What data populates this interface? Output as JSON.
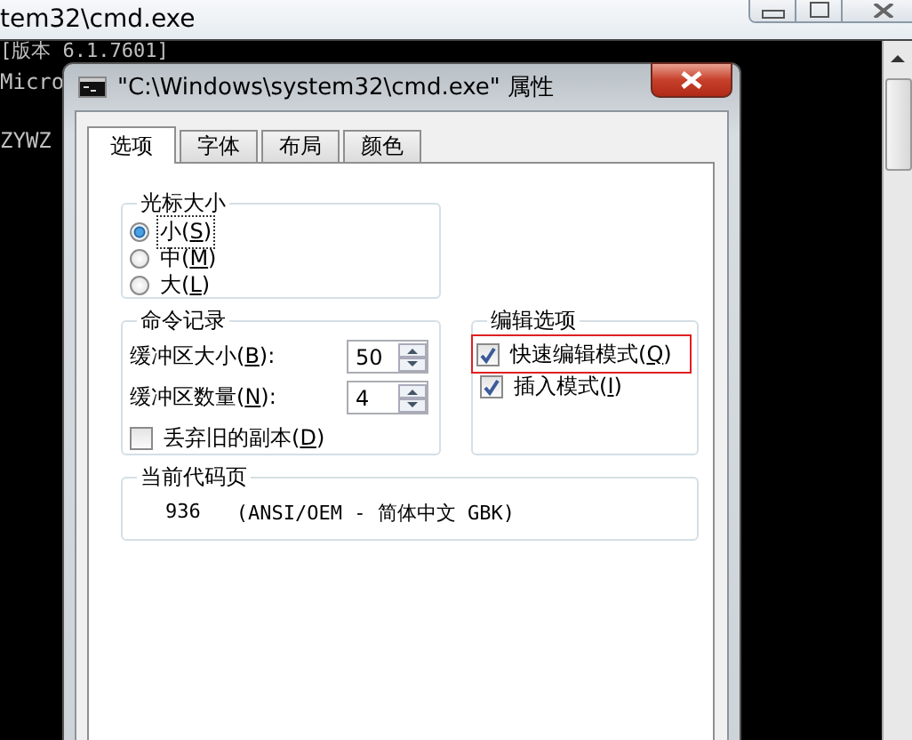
{
  "console_window": {
    "title": "tem32\\cmd.exe",
    "lines": [
      "[版本 6.1.7601]",
      "Micro",
      "ZYWZ"
    ]
  },
  "dialog": {
    "title": "\"C:\\Windows\\system32\\cmd.exe\" 属性",
    "tabs": [
      {
        "label": "选项",
        "selected": true
      },
      {
        "label": "字体",
        "selected": false
      },
      {
        "label": "布局",
        "selected": false
      },
      {
        "label": "颜色",
        "selected": false
      }
    ],
    "cursor_size": {
      "title": "光标大小",
      "options": [
        {
          "before": "小(",
          "key": "S",
          "after": ")",
          "selected": true
        },
        {
          "before": "中(",
          "key": "M",
          "after": ")",
          "selected": false
        },
        {
          "before": "大(",
          "key": "L",
          "after": ")",
          "selected": false
        }
      ]
    },
    "command_history": {
      "title": "命令记录",
      "spinners": [
        {
          "before": "缓冲区大小(",
          "key": "B",
          "after": "):",
          "value": "50"
        },
        {
          "before": "缓冲区数量(",
          "key": "N",
          "after": "):",
          "value": "4"
        }
      ],
      "checkbox": {
        "before": "丢弃旧的副本(",
        "key": "D",
        "after": ")",
        "checked": false
      }
    },
    "edit_options": {
      "title": "编辑选项",
      "options": [
        {
          "before": "快速编辑模式(",
          "key": "Q",
          "after": ")",
          "checked": true,
          "highlighted": true
        },
        {
          "before": "插入模式(",
          "key": "I",
          "after": ")",
          "checked": true,
          "highlighted": false
        }
      ]
    },
    "code_page": {
      "title": "当前代码页",
      "number": "936",
      "name": "(ANSI/OEM - 简体中文 GBK)"
    }
  }
}
